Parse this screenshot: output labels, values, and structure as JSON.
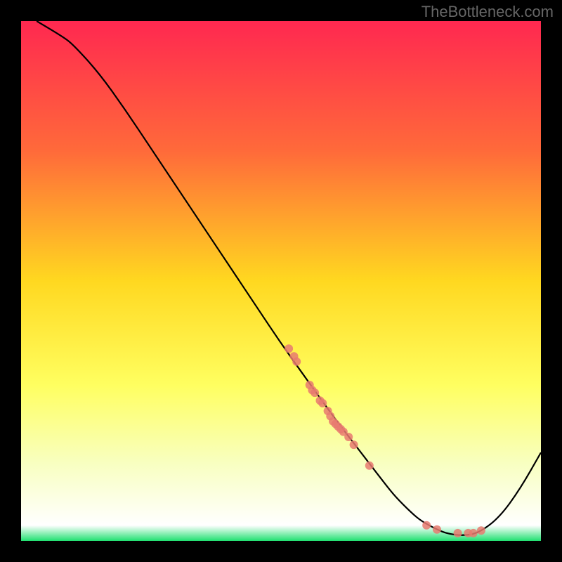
{
  "watermark": "TheBottleneck.com",
  "chart_data": {
    "type": "line",
    "title": "",
    "xlabel": "",
    "ylabel": "",
    "xlim": [
      0,
      100
    ],
    "ylim": [
      0,
      100
    ],
    "background_gradient_stops": [
      {
        "offset": 0,
        "color": "#ff2850"
      },
      {
        "offset": 25,
        "color": "#ff6a3a"
      },
      {
        "offset": 50,
        "color": "#ffd820"
      },
      {
        "offset": 70,
        "color": "#ffff60"
      },
      {
        "offset": 85,
        "color": "#f8ffc0"
      },
      {
        "offset": 97,
        "color": "#ffffff"
      },
      {
        "offset": 100,
        "color": "#20e070"
      }
    ],
    "series": [
      {
        "name": "bottleneck-curve",
        "type": "line",
        "color": "#000000",
        "x": [
          3,
          8,
          10,
          15,
          20,
          25,
          30,
          35,
          40,
          45,
          50,
          55,
          60,
          65,
          70,
          72,
          75,
          77,
          80,
          82,
          85,
          88,
          92,
          96,
          100
        ],
        "y": [
          100,
          97,
          95.5,
          90,
          83,
          75.5,
          68,
          60.5,
          53,
          45.5,
          38,
          31,
          24,
          17.5,
          11,
          8.5,
          5.5,
          3.8,
          2.2,
          1.4,
          1.0,
          1.5,
          4.5,
          10,
          17
        ]
      },
      {
        "name": "cluster-points",
        "type": "scatter",
        "color": "#e77a70",
        "radius": 6,
        "points": [
          {
            "x": 51.5,
            "y": 37.0
          },
          {
            "x": 52.5,
            "y": 35.5
          },
          {
            "x": 53.0,
            "y": 34.5
          },
          {
            "x": 55.5,
            "y": 30.0
          },
          {
            "x": 56.0,
            "y": 29.0
          },
          {
            "x": 56.5,
            "y": 28.5
          },
          {
            "x": 57.5,
            "y": 27.0
          },
          {
            "x": 58.0,
            "y": 26.5
          },
          {
            "x": 59.0,
            "y": 25.0
          },
          {
            "x": 59.5,
            "y": 24.0
          },
          {
            "x": 60.0,
            "y": 23.0
          },
          {
            "x": 60.5,
            "y": 22.5
          },
          {
            "x": 61.0,
            "y": 22.0
          },
          {
            "x": 61.5,
            "y": 21.5
          },
          {
            "x": 62.0,
            "y": 21.0
          },
          {
            "x": 63.0,
            "y": 20.0
          },
          {
            "x": 64.0,
            "y": 18.5
          },
          {
            "x": 67.0,
            "y": 14.5
          },
          {
            "x": 78.0,
            "y": 3.0
          },
          {
            "x": 80.0,
            "y": 2.2
          },
          {
            "x": 84.0,
            "y": 1.5
          },
          {
            "x": 86.0,
            "y": 1.5
          },
          {
            "x": 87.0,
            "y": 1.5
          },
          {
            "x": 88.5,
            "y": 2.0
          }
        ]
      }
    ]
  }
}
